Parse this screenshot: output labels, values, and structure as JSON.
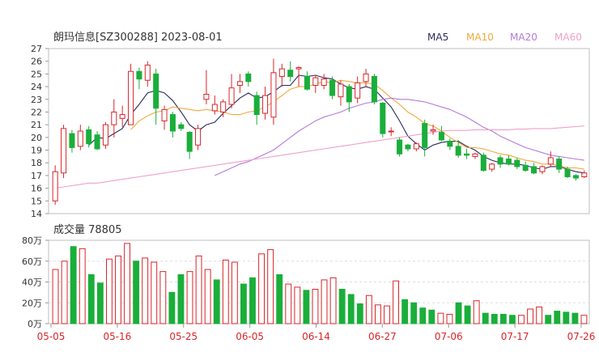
{
  "chart_data": [
    {
      "type": "candlestick",
      "title": "朗玛信息[SZ300288] 2023-08-01",
      "ylim": [
        14,
        27
      ],
      "y_ticks": [
        "27",
        "26",
        "25",
        "24",
        "23",
        "22",
        "21",
        "20",
        "19",
        "18",
        "17",
        "16",
        "15",
        "14"
      ],
      "legend": [
        {
          "name": "MA5",
          "color": "#2b2b5e"
        },
        {
          "name": "MA10",
          "color": "#f2a93b"
        },
        {
          "name": "MA20",
          "color": "#b57ad9"
        },
        {
          "name": "MA60",
          "color": "#f0a0c8"
        }
      ],
      "candles": [
        [
          15.0,
          17.3,
          14.7,
          17.8
        ],
        [
          17.2,
          20.7,
          16.8,
          21.0
        ],
        [
          20.3,
          19.2,
          18.8,
          20.6
        ],
        [
          19.3,
          20.5,
          19.0,
          21.0
        ],
        [
          20.6,
          19.5,
          19.2,
          20.9
        ],
        [
          20.2,
          19.1,
          19.0,
          20.5
        ],
        [
          19.4,
          21.0,
          19.1,
          21.2
        ],
        [
          21.0,
          22.0,
          20.0,
          23.0
        ],
        [
          21.5,
          21.8,
          20.8,
          22.5
        ],
        [
          21.0,
          25.2,
          21.0,
          25.8
        ],
        [
          25.2,
          24.6,
          23.8,
          25.5
        ],
        [
          24.5,
          25.7,
          24.0,
          26.0
        ],
        [
          25.0,
          22.3,
          21.0,
          25.4
        ],
        [
          21.3,
          22.2,
          20.6,
          22.5
        ],
        [
          21.8,
          20.5,
          20.0,
          22.0
        ],
        [
          21.0,
          20.7,
          20.5,
          21.2
        ],
        [
          20.4,
          18.9,
          18.3,
          20.5
        ],
        [
          19.4,
          20.7,
          19.0,
          21.0
        ],
        [
          23.0,
          23.4,
          22.6,
          25.3
        ],
        [
          22.1,
          22.6,
          21.8,
          23.3
        ],
        [
          22.0,
          22.8,
          21.6,
          23.0
        ],
        [
          22.6,
          23.9,
          22.3,
          25.0
        ],
        [
          24.1,
          24.4,
          23.5,
          25.0
        ],
        [
          25.0,
          24.4,
          24.0,
          25.2
        ],
        [
          23.3,
          21.8,
          21.0,
          23.6
        ],
        [
          21.9,
          23.3,
          21.4,
          24.0
        ],
        [
          21.6,
          25.1,
          21.0,
          26.2
        ],
        [
          24.8,
          25.4,
          24.0,
          25.8
        ],
        [
          25.3,
          24.8,
          24.4,
          26.0
        ],
        [
          25.4,
          25.5,
          24.0,
          25.6
        ],
        [
          24.8,
          23.8,
          23.7,
          25.2
        ],
        [
          24.1,
          24.7,
          23.5,
          24.9
        ],
        [
          24.1,
          24.6,
          23.8,
          25.0
        ],
        [
          24.5,
          23.3,
          23.0,
          24.8
        ],
        [
          23.2,
          24.2,
          22.5,
          24.5
        ],
        [
          24.0,
          22.8,
          22.0,
          24.2
        ],
        [
          23.1,
          24.3,
          22.7,
          24.8
        ],
        [
          24.4,
          25.0,
          24.0,
          25.4
        ],
        [
          24.8,
          22.8,
          22.6,
          25.0
        ],
        [
          22.7,
          20.3,
          20.0,
          22.8
        ],
        [
          20.5,
          20.5,
          20.1,
          20.8
        ],
        [
          19.8,
          18.7,
          18.5,
          20.0
        ],
        [
          19.4,
          19.1,
          18.9,
          19.5
        ],
        [
          19.1,
          19.5,
          18.9,
          19.6
        ],
        [
          21.1,
          19.2,
          18.5,
          21.4
        ],
        [
          20.5,
          20.6,
          20.2,
          21.0
        ],
        [
          20.4,
          19.8,
          19.7,
          20.9
        ],
        [
          19.7,
          19.3,
          19.0,
          19.9
        ],
        [
          19.3,
          18.6,
          18.4,
          19.8
        ],
        [
          18.7,
          18.6,
          18.3,
          19.1
        ],
        [
          18.5,
          18.7,
          18.3,
          18.8
        ],
        [
          18.6,
          17.4,
          17.3,
          18.8
        ],
        [
          17.5,
          17.9,
          17.3,
          18.0
        ],
        [
          18.4,
          17.9,
          17.6,
          18.6
        ],
        [
          18.3,
          17.9,
          17.8,
          18.6
        ],
        [
          18.2,
          17.7,
          17.5,
          18.4
        ],
        [
          17.8,
          17.4,
          17.3,
          18.1
        ],
        [
          17.7,
          17.2,
          17.1,
          18.0
        ],
        [
          17.3,
          17.7,
          17.1,
          17.8
        ],
        [
          17.9,
          18.4,
          17.7,
          18.9
        ],
        [
          18.3,
          17.5,
          17.2,
          18.5
        ],
        [
          17.5,
          16.9,
          16.8,
          17.7
        ],
        [
          17.0,
          16.8,
          16.6,
          17.1
        ],
        [
          16.9,
          17.2,
          16.8,
          17.4
        ]
      ],
      "moving_averages": {
        "MA5": [
          null,
          null,
          null,
          null,
          19.4,
          20.0,
          19.9,
          20.3,
          20.7,
          21.8,
          22.6,
          23.5,
          23.7,
          23.5,
          22.9,
          22.0,
          21.0,
          20.5,
          21.0,
          21.2,
          21.9,
          22.5,
          23.1,
          23.5,
          23.1,
          23.2,
          23.6,
          24.1,
          24.1,
          24.9,
          24.8,
          24.9,
          24.7,
          24.6,
          24.2,
          23.9,
          23.8,
          24.0,
          23.8,
          23.1,
          22.4,
          21.3,
          20.1,
          19.5,
          19.0,
          19.4,
          19.6,
          19.7,
          19.7,
          19.3,
          19.0,
          18.5,
          18.2,
          18.0,
          17.9,
          17.9,
          17.8,
          17.6,
          17.5,
          17.7,
          17.7,
          17.5,
          17.3,
          17.2
        ],
        "MA10": [
          null,
          null,
          null,
          null,
          null,
          null,
          null,
          null,
          null,
          20.6,
          21.3,
          21.7,
          22.0,
          22.1,
          22.4,
          22.3,
          22.2,
          22.1,
          22.2,
          22.1,
          22.0,
          21.8,
          21.8,
          22.0,
          22.1,
          22.4,
          22.8,
          23.3,
          23.8,
          24.0,
          24.0,
          24.2,
          24.4,
          24.3,
          24.5,
          24.4,
          24.3,
          24.3,
          24.2,
          23.7,
          23.1,
          22.6,
          22.0,
          21.6,
          21.1,
          20.9,
          20.5,
          20.0,
          19.6,
          19.2,
          19.2,
          19.1,
          18.9,
          18.7,
          18.6,
          18.4,
          18.2,
          18.1,
          17.9,
          17.9,
          17.8,
          17.6,
          17.6,
          17.5
        ],
        "MA20": [
          null,
          null,
          null,
          null,
          null,
          null,
          null,
          null,
          null,
          null,
          null,
          null,
          null,
          null,
          null,
          null,
          null,
          null,
          null,
          17.0,
          17.3,
          17.6,
          17.9,
          18.1,
          18.4,
          18.7,
          19.0,
          19.5,
          20.0,
          20.5,
          20.9,
          21.3,
          21.6,
          21.8,
          22.0,
          22.3,
          22.5,
          22.7,
          22.8,
          23.0,
          23.1,
          23.0,
          23.0,
          22.9,
          22.8,
          22.6,
          22.4,
          22.2,
          21.9,
          21.6,
          21.2,
          20.8,
          20.5,
          20.1,
          19.8,
          19.5,
          19.2,
          19.0,
          18.8,
          18.6,
          18.5,
          18.4,
          18.3,
          18.2
        ],
        "MA60": [
          16.0,
          16.1,
          16.2,
          16.3,
          16.4,
          16.4,
          16.5,
          16.6,
          16.7,
          16.8,
          16.9,
          17.0,
          17.1,
          17.2,
          17.3,
          17.4,
          17.5,
          17.6,
          17.7,
          17.8,
          17.9,
          18.0,
          18.1,
          18.2,
          18.3,
          18.4,
          18.5,
          18.6,
          18.7,
          18.8,
          18.9,
          19.0,
          19.1,
          19.2,
          19.3,
          19.4,
          19.5,
          19.6,
          19.7,
          19.8,
          19.9,
          20.0,
          20.1,
          20.2,
          20.3,
          20.4,
          20.5,
          20.55,
          20.55,
          20.55,
          20.6,
          20.6,
          20.6,
          20.6,
          20.6,
          20.65,
          20.65,
          20.7,
          20.7,
          20.7,
          20.75,
          20.8,
          20.85,
          20.9
        ]
      }
    },
    {
      "type": "bar",
      "title": "成交量 78805",
      "ylim": [
        0,
        80
      ],
      "y_ticks": [
        "80万",
        "60万",
        "40万",
        "20万",
        "0万"
      ],
      "x_tick_labels": [
        "05-05",
        "05-16",
        "05-25",
        "06-05",
        "06-14",
        "06-27",
        "07-06",
        "07-17",
        "07-26"
      ],
      "values": [
        52,
        60,
        74,
        72,
        47,
        39,
        62,
        65,
        77,
        60,
        63,
        59,
        50,
        30,
        47,
        50,
        65,
        52,
        42,
        61,
        59,
        38,
        44,
        67,
        71,
        47,
        38,
        35,
        32,
        33,
        42,
        44,
        33,
        28,
        19,
        27,
        18,
        17,
        41,
        23,
        20,
        15,
        13,
        10,
        9,
        20,
        17,
        22,
        10,
        9,
        9,
        8,
        8,
        14,
        16,
        8,
        12,
        11,
        10,
        8
      ],
      "volume_up": [
        true,
        true,
        false,
        true,
        false,
        false,
        true,
        true,
        true,
        false,
        true,
        true,
        true,
        false,
        false,
        true,
        true,
        true,
        false,
        true,
        true,
        false,
        false,
        true,
        true,
        false,
        true,
        true,
        false,
        true,
        true,
        true,
        false,
        false,
        false,
        true,
        true,
        true,
        true,
        false,
        false,
        false,
        false,
        true,
        true,
        false,
        false,
        true,
        false,
        false,
        false,
        false,
        true,
        true,
        true,
        false,
        false,
        false,
        false,
        true
      ]
    }
  ]
}
